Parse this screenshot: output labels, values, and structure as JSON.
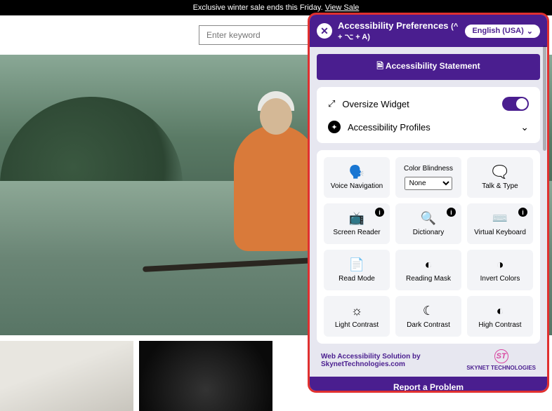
{
  "banner": {
    "text": "Exclusive winter sale ends this Friday. ",
    "link": "View Sale"
  },
  "search": {
    "placeholder": "Enter keyword"
  },
  "panel": {
    "title": "Accessibility Preferences",
    "shortcut": "(^ + ⌥ + A)",
    "language": "English (USA)",
    "statement": "Accessibility Statement",
    "oversize": {
      "label": "Oversize Widget",
      "on": true
    },
    "profiles": {
      "label": "Accessibility Profiles"
    },
    "tiles": {
      "voice_nav": "Voice Navigation",
      "color_blindness": {
        "label": "Color Blindness",
        "value": "None"
      },
      "talk_type": "Talk & Type",
      "screen_reader": "Screen Reader",
      "dictionary": "Dictionary",
      "virtual_keyboard": "Virtual Keyboard",
      "read_mode": "Read Mode",
      "reading_mask": "Reading Mask",
      "invert_colors": "Invert Colors",
      "light_contrast": "Light Contrast",
      "dark_contrast": "Dark Contrast",
      "high_contrast": "High Contrast"
    },
    "credit": {
      "line1": "Web Accessibility Solution by",
      "line2": "SkynetTechnologies.com",
      "brand": "SKYNET TECHNOLOGIES",
      "logo": "ST"
    },
    "report": "Report a Problem"
  }
}
